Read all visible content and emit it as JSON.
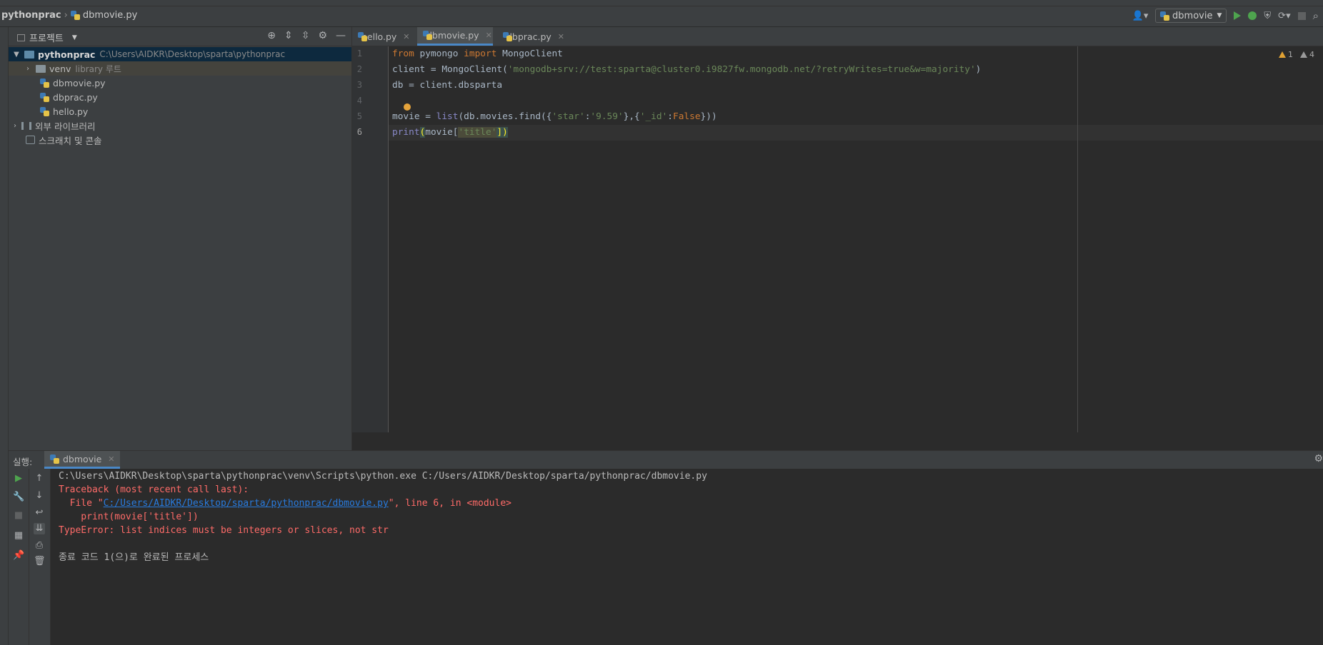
{
  "navbar": {
    "project": "pythonprac",
    "file": "dbmovie.py",
    "run_config": "dbmovie"
  },
  "project_panel": {
    "title": "프로젝트",
    "root": {
      "name": "pythonprac",
      "path": "C:\\Users\\AIDKR\\Desktop\\sparta\\pythonprac"
    },
    "venv": {
      "name": "venv",
      "note": "library 루트"
    },
    "files": [
      "dbmovie.py",
      "dbprac.py",
      "hello.py"
    ],
    "external_libraries": "외부 라이브러리",
    "scratches": "스크래치 및 콘솔"
  },
  "tabs": [
    {
      "label": "hello.py",
      "active": false
    },
    {
      "label": "dbmovie.py",
      "active": true
    },
    {
      "label": "dbprac.py",
      "active": false
    }
  ],
  "editor": {
    "line_numbers": [
      "1",
      "2",
      "3",
      "4",
      "5",
      "6"
    ],
    "line1": {
      "kw1": "from",
      "mod": " pymongo ",
      "kw2": "import",
      "name": " MongoClient"
    },
    "line2": {
      "pre": "client = MongoClient(",
      "str": "'mongodb+srv://test:sparta@cluster0.i9827fw.mongodb.net/?retryWrites=true&w=majority'",
      "post": ")"
    },
    "line3": {
      "text": "db = client.dbsparta"
    },
    "line5": {
      "pre": "movie = ",
      "fn": "list",
      "mid": "(db.movies.find({",
      "s1": "'star'",
      "c1": ":",
      "s2": "'9.59'",
      "c2": "},{",
      "s3": "'_id'",
      "c3": ":",
      "kw": "False",
      "post": "}))"
    },
    "line6": {
      "fn": "print",
      "open": "(",
      "mid": "movie[",
      "str": "'title'",
      "close": "])"
    },
    "warnings": {
      "warn_count": "1",
      "weak_count": "4"
    }
  },
  "run_panel": {
    "label": "실행:",
    "tab": "dbmovie",
    "console": {
      "cmd": "C:\\Users\\AIDKR\\Desktop\\sparta\\pythonprac\\venv\\Scripts\\python.exe C:/Users/AIDKR/Desktop/sparta/pythonprac/dbmovie.py",
      "traceback": "Traceback (most recent call last):",
      "file_pre": "  File \"",
      "file_link": "C:/Users/AIDKR/Desktop/sparta/pythonprac/dbmovie.py",
      "file_post": "\", line 6, in <module>",
      "code": "    print(movie['title'])",
      "error": "TypeError: list indices must be integers or slices, not str",
      "exit": "종료 코드 1(으)로 완료된 프로세스"
    }
  }
}
